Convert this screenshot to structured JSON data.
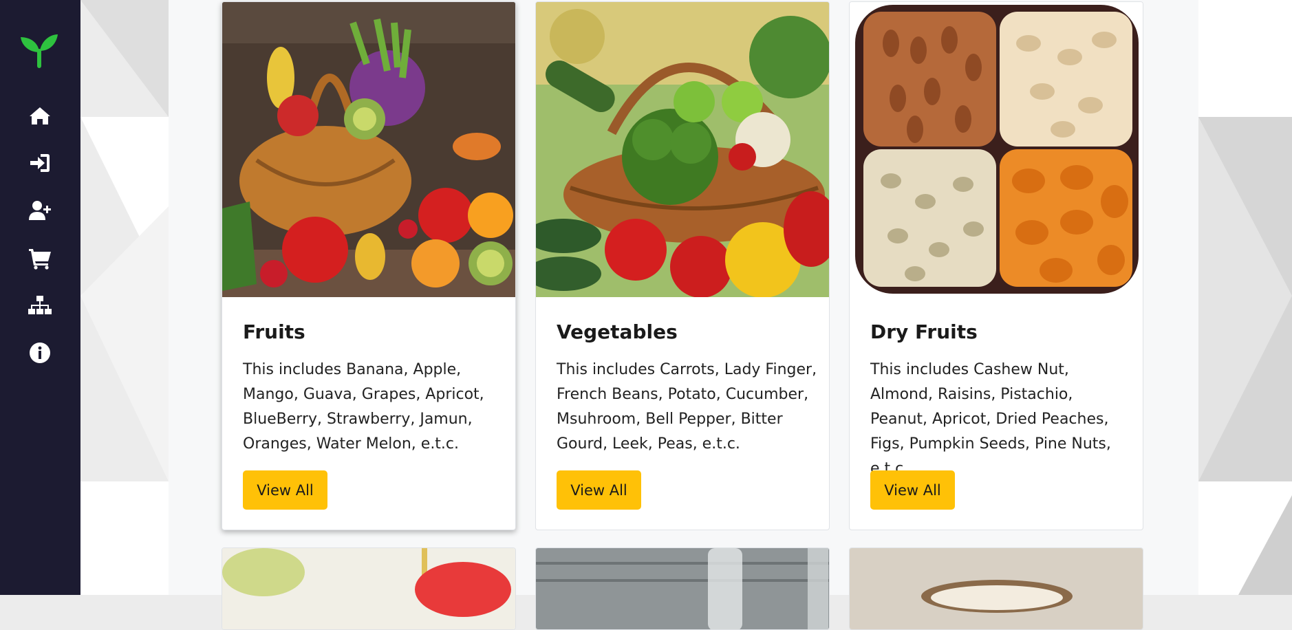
{
  "nav": {
    "brand_icon": "sprout-icon",
    "items": [
      {
        "icon": "home-icon"
      },
      {
        "icon": "login-icon"
      },
      {
        "icon": "user-plus-icon"
      },
      {
        "icon": "cart-icon"
      },
      {
        "icon": "sitemap-icon"
      },
      {
        "icon": "info-icon"
      }
    ]
  },
  "categories": [
    {
      "title": "Fruits",
      "description": "This includes Banana, Apple, Mango, Guava, Grapes, Apricot, BlueBerry, Strawberry, Jamun, Oranges, Water Melon, e.t.c.",
      "button": "View All"
    },
    {
      "title": "Vegetables",
      "description": "This includes Carrots, Lady Finger, French Beans, Potato, Cucumber, Msuhroom, Bell Pepper, Bitter Gourd, Leek, Peas, e.t.c.",
      "button": "View All"
    },
    {
      "title": "Dry Fruits",
      "description": "This includes Cashew Nut, Almond, Raisins, Pistachio, Peanut, Apricot, Dried Peaches, Figs, Pumpkin Seeds, Pine Nuts, e.t.c.",
      "button": "View All"
    }
  ],
  "colors": {
    "sidebar": "#1c1b31",
    "brand_green": "#2ec23f",
    "button": "#ffc107"
  }
}
